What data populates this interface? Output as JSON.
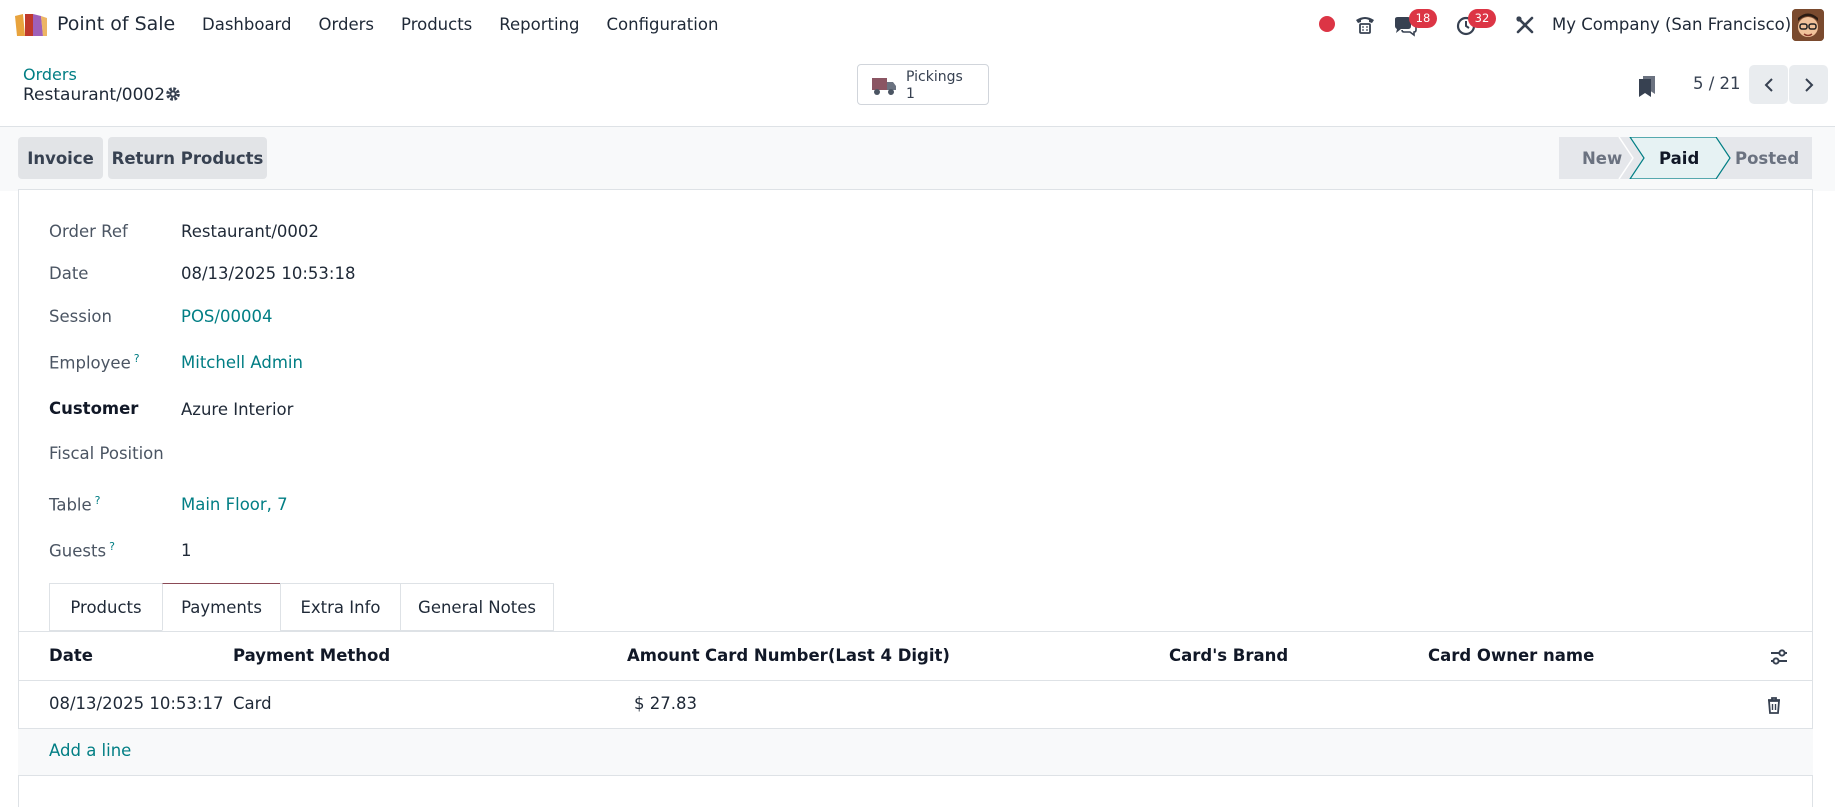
{
  "navbar": {
    "app_name": "Point of Sale",
    "menu": [
      "Dashboard",
      "Orders",
      "Products",
      "Reporting",
      "Configuration"
    ],
    "messages_count": "18",
    "activities_count": "32",
    "company": "My Company (San Francisco)"
  },
  "control": {
    "breadcrumb": "Orders",
    "record_name": "Restaurant/0002",
    "smart_button_label": "Pickings",
    "smart_button_value": "1",
    "pager": "5 / 21"
  },
  "actions": {
    "invoice": "Invoice",
    "return_products": "Return Products"
  },
  "status": {
    "stages": [
      "New",
      "Paid",
      "Posted"
    ],
    "current": "Paid"
  },
  "form": {
    "order_ref_label": "Order Ref",
    "order_ref": "Restaurant/0002",
    "date_label": "Date",
    "date": "08/13/2025 10:53:18",
    "session_label": "Session",
    "session": "POS/00004",
    "employee_label": "Employee",
    "employee": "Mitchell Admin",
    "customer_label": "Customer",
    "customer": "Azure Interior",
    "fiscal_position_label": "Fiscal Position",
    "fiscal_position": "",
    "table_label": "Table",
    "table": "Main Floor, 7",
    "guests_label": "Guests",
    "guests": "1",
    "help_mark": "?"
  },
  "tabs": [
    "Products",
    "Payments",
    "Extra Info",
    "General Notes"
  ],
  "payments": {
    "columns": [
      "Date",
      "Payment Method",
      "Amount",
      "Card Number(Last 4 Digit)",
      "Card's Brand",
      "Card Owner name"
    ],
    "rows": [
      {
        "date": "08/13/2025 10:53:17",
        "method": "Card",
        "amount": "$ 27.83",
        "card_number": "",
        "brand": "",
        "owner": ""
      }
    ],
    "add_line": "Add a line"
  },
  "colors": {
    "accent": "#017e84",
    "badge": "#dc3545",
    "active_tab": "#8b4a56"
  }
}
